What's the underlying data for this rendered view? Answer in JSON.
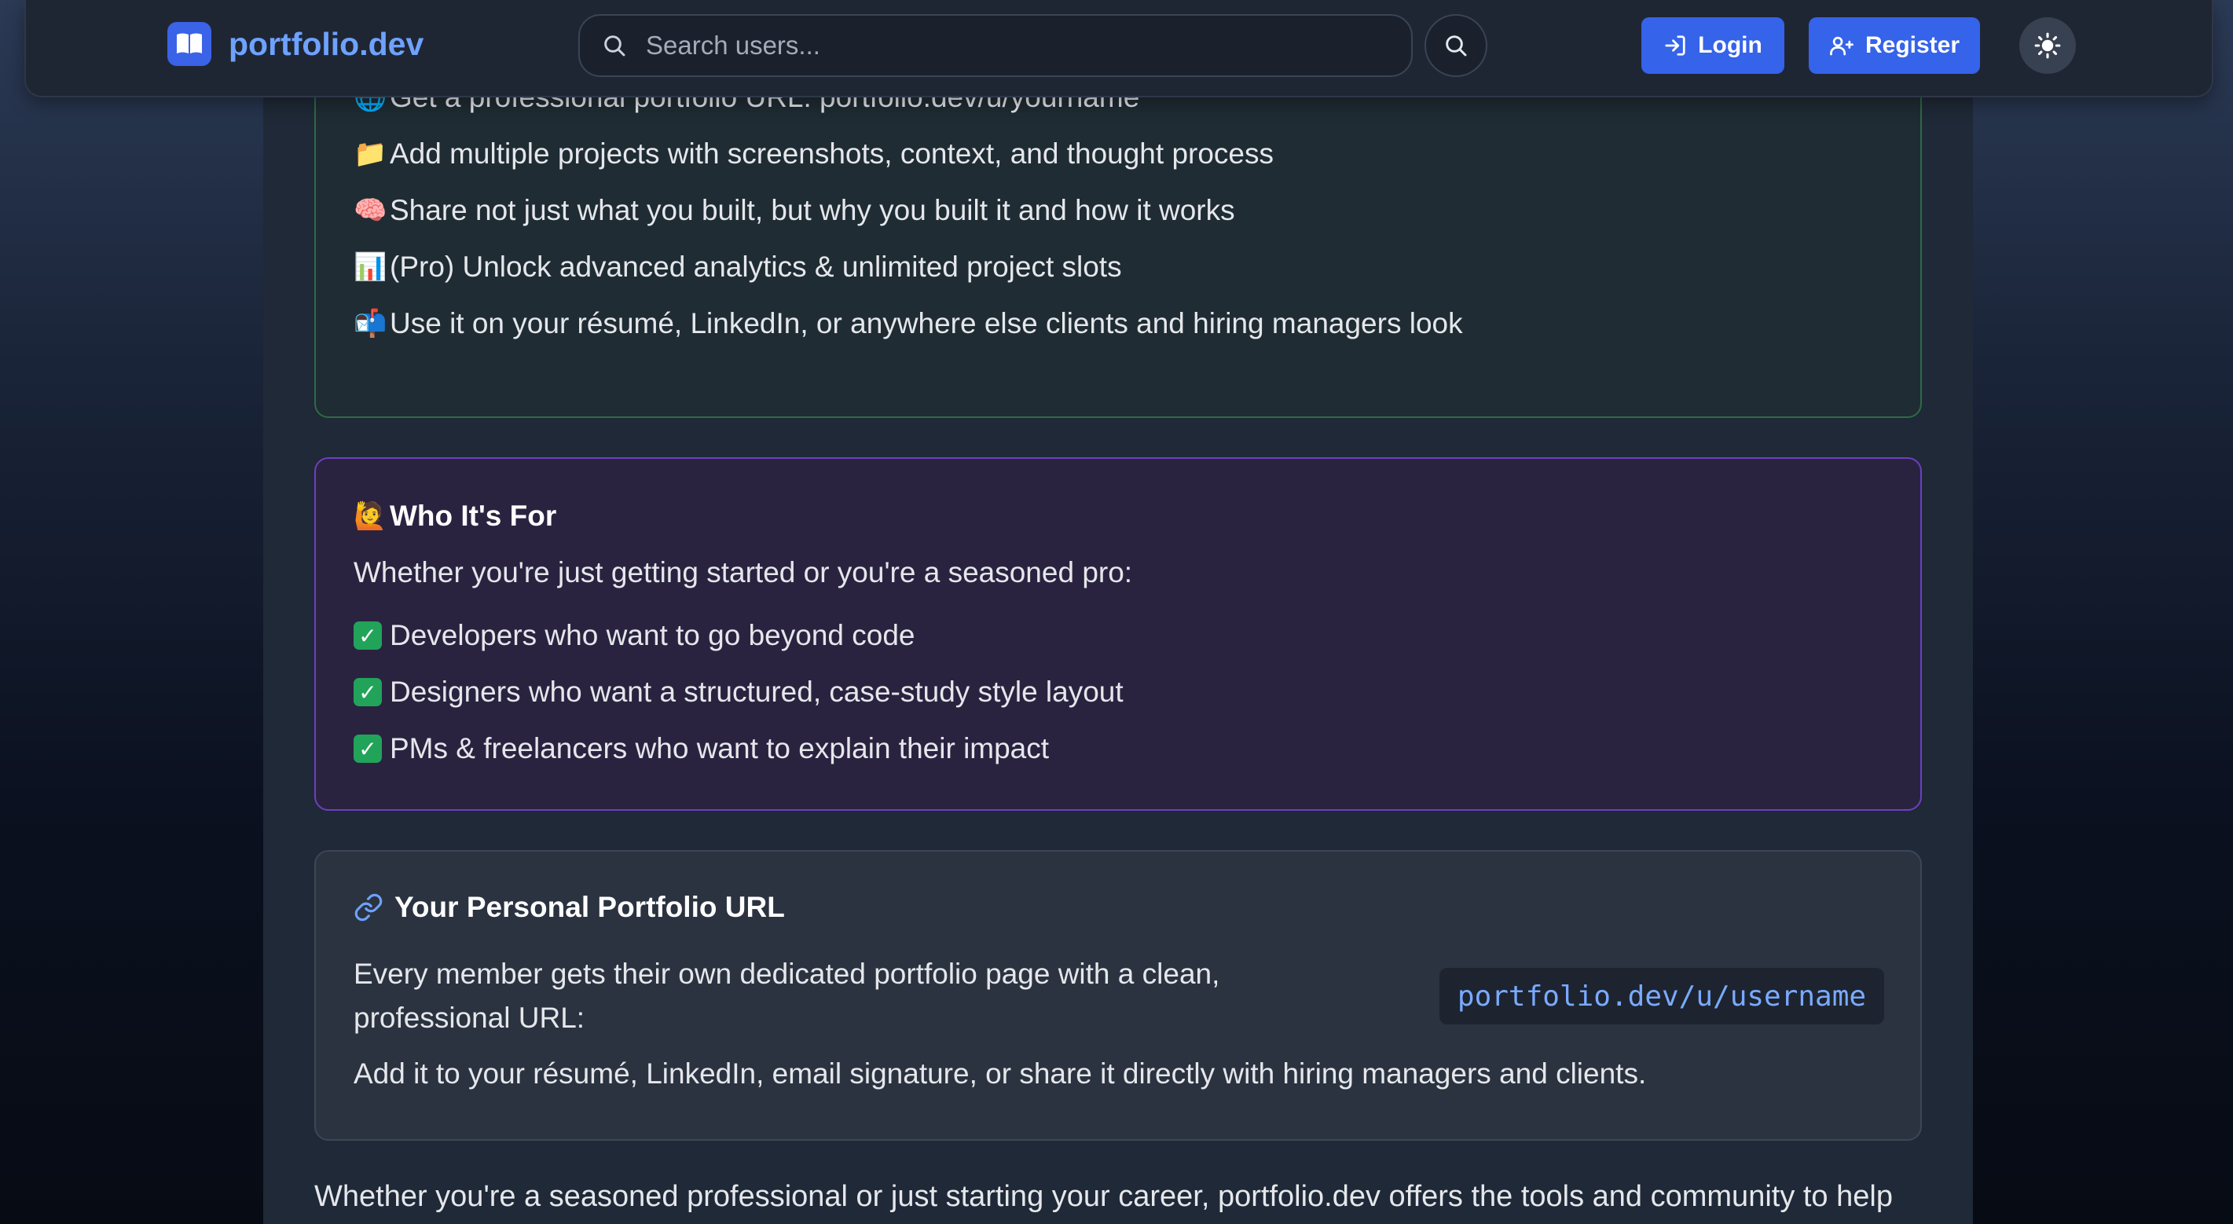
{
  "header": {
    "brand": "portfolio.dev",
    "search_placeholder": "Search users...",
    "login_label": "Login",
    "register_label": "Register"
  },
  "features": {
    "items": [
      {
        "icon": "🌐",
        "text": "Get a professional portfolio URL: portfolio.dev/u/yourname"
      },
      {
        "icon": "📁",
        "text": "Add multiple projects with screenshots, context, and thought process"
      },
      {
        "icon": "🧠",
        "text": "Share not just what you built, but why you built it and how it works"
      },
      {
        "icon": "📊",
        "text": "(Pro) Unlock advanced analytics & unlimited project slots"
      },
      {
        "icon": "📬",
        "text": "Use it on your résumé, LinkedIn, or anywhere else clients and hiring managers look"
      }
    ]
  },
  "who": {
    "icon": "🙋",
    "title": "Who It's For",
    "intro": "Whether you're just getting started or you're a seasoned pro:",
    "items": [
      "Developers who want to go beyond code",
      "Designers who want a structured, case-study style layout",
      "PMs & freelancers who want to explain their impact"
    ]
  },
  "url_card": {
    "title": "Your Personal Portfolio URL",
    "description": "Every member gets their own dedicated portfolio page with a clean, professional URL:",
    "url_example": "portfolio.dev/u/username",
    "note": "Add it to your résumé, LinkedIn, email signature, or share it directly with hiring managers and clients."
  },
  "footer_text": "Whether you're a seasoned professional or just starting your career, portfolio.dev offers the tools and community to help",
  "colors": {
    "primary": "#3563e9",
    "brand_text": "#6ea2ff",
    "green_border": "#2f6b45",
    "purple_border": "#6d3fc2"
  }
}
